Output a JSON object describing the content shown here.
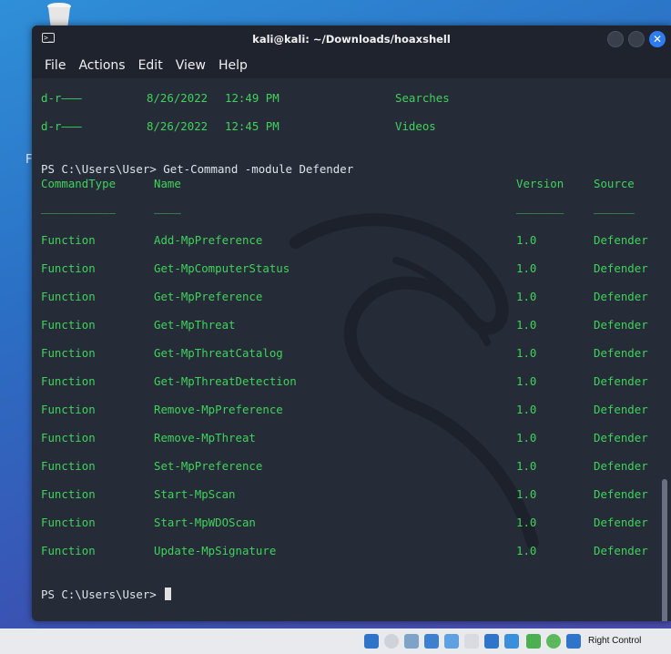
{
  "window": {
    "title": "kali@kali: ~/Downloads/hoaxshell",
    "close_glyph": "✕",
    "terminal_icon_glyph": ">_"
  },
  "menu": [
    "File",
    "Actions",
    "Edit",
    "View",
    "Help"
  ],
  "desktop": {
    "letter": "F"
  },
  "dir_rows": [
    {
      "mode": "d-r———",
      "date": "8/26/2022",
      "time": "12:49 PM",
      "name": "Searches"
    },
    {
      "mode": "d-r———",
      "date": "8/26/2022",
      "time": "12:45 PM",
      "name": "Videos"
    }
  ],
  "command_line": "PS C:\\Users\\User> Get-Command -module Defender",
  "table": {
    "headers": [
      "CommandType",
      "Name",
      "Version",
      "Source"
    ],
    "separators": [
      "___________",
      "____",
      "_______",
      "______"
    ],
    "rows": [
      [
        "Function",
        "Add-MpPreference",
        "1.0",
        "Defender"
      ],
      [
        "Function",
        "Get-MpComputerStatus",
        "1.0",
        "Defender"
      ],
      [
        "Function",
        "Get-MpPreference",
        "1.0",
        "Defender"
      ],
      [
        "Function",
        "Get-MpThreat",
        "1.0",
        "Defender"
      ],
      [
        "Function",
        "Get-MpThreatCatalog",
        "1.0",
        "Defender"
      ],
      [
        "Function",
        "Get-MpThreatDetection",
        "1.0",
        "Defender"
      ],
      [
        "Function",
        "Remove-MpPreference",
        "1.0",
        "Defender"
      ],
      [
        "Function",
        "Remove-MpThreat",
        "1.0",
        "Defender"
      ],
      [
        "Function",
        "Set-MpPreference",
        "1.0",
        "Defender"
      ],
      [
        "Function",
        "Start-MpScan",
        "1.0",
        "Defender"
      ],
      [
        "Function",
        "Start-MpWDOScan",
        "1.0",
        "Defender"
      ],
      [
        "Function",
        "Update-MpSignature",
        "1.0",
        "Defender"
      ]
    ]
  },
  "prompt": "PS C:\\Users\\User> ",
  "taskbar": {
    "host_key_label": "Right Control"
  },
  "colors": {
    "terminal_green": "#3fd35a",
    "terminal_bg": "#262b38",
    "close_button": "#2f7bf0"
  }
}
